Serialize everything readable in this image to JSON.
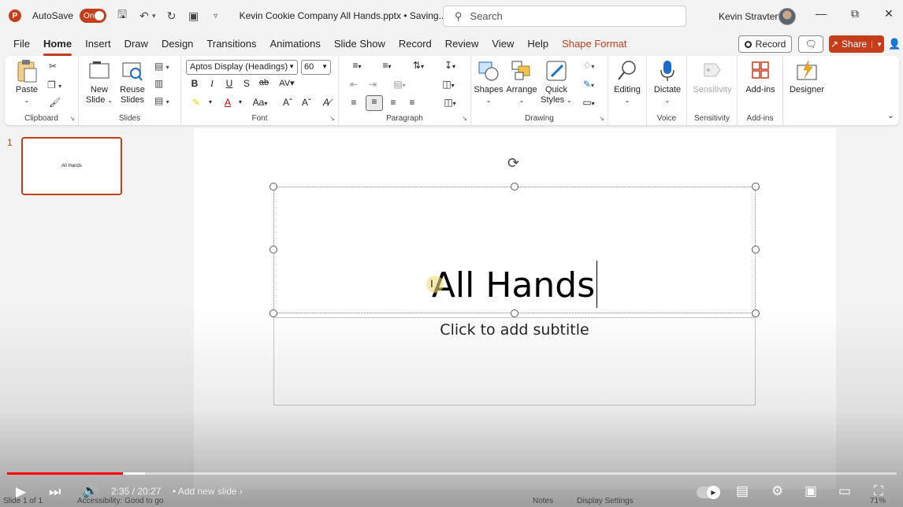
{
  "titlebar": {
    "app_logo_letter": "P",
    "autosave_label": "AutoSave",
    "autosave_state": "On",
    "document_title": "Kevin Cookie Company All Hands.pptx • Saving...",
    "search_placeholder": "Search",
    "user_name": "Kevin Stravtert"
  },
  "menu": {
    "tabs": [
      "File",
      "Home",
      "Insert",
      "Draw",
      "Design",
      "Transitions",
      "Animations",
      "Slide Show",
      "Record",
      "Review",
      "View",
      "Help",
      "Shape Format"
    ],
    "active_tab": "Home",
    "record_label": "Record",
    "share_label": "Share"
  },
  "ribbon": {
    "clipboard": {
      "label": "Clipboard",
      "paste": "Paste"
    },
    "slides": {
      "label": "Slides",
      "new_slide_line1": "New",
      "new_slide_line2": "Slide",
      "reuse_line1": "Reuse",
      "reuse_line2": "Slides"
    },
    "font": {
      "label": "Font",
      "font_name": "Aptos Display (Headings)",
      "font_size": "60"
    },
    "paragraph": {
      "label": "Paragraph"
    },
    "drawing": {
      "label": "Drawing",
      "shapes": "Shapes",
      "arrange": "Arrange",
      "quick_line1": "Quick",
      "quick_line2": "Styles"
    },
    "editing": {
      "label": "Editing"
    },
    "voice": {
      "label": "Voice",
      "dictate": "Dictate"
    },
    "sensitivity": {
      "label": "Sensitivity",
      "button": "Sensitivity"
    },
    "addins": {
      "label": "Add-ins",
      "button": "Add-ins"
    },
    "designer": {
      "button": "Designer"
    }
  },
  "slide_pane": {
    "slide_number": "1",
    "thumb_title": "All Hands"
  },
  "slide": {
    "title": "All Hands",
    "subtitle_placeholder": "Click to add subtitle"
  },
  "player": {
    "time": "2:35 / 20:27",
    "chapter": "• Add new slide",
    "progress_played": 0.13,
    "progress_buffered": 0.155
  },
  "statusbar": {
    "slide_of": "Slide 1 of 1",
    "accessibility": "Accessibility: Good to go",
    "notes": "Notes",
    "display_settings": "Display Settings",
    "zoom": "71%"
  },
  "colors": {
    "accent": "#c43e1c",
    "progress_red": "#ff0000"
  }
}
